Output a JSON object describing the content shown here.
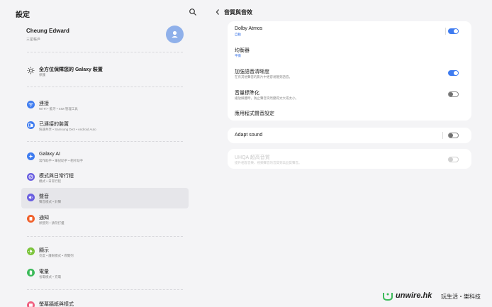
{
  "left": {
    "title": "設定",
    "account": {
      "name": "Cheung Edward",
      "subtitle": "三星帳戶"
    },
    "items": [
      {
        "label": "全方位保障您的 Galaxy 裝置",
        "sub": "保護",
        "icon": "bulb-icon",
        "color": "#ffffff"
      },
      {
        "label": "連接",
        "sub": "Wi-Fi • 藍牙 • SIM 管理工具",
        "icon": "wifi-icon",
        "color": "#3f7cf0"
      },
      {
        "label": "已連接的裝置",
        "sub": "快速共享 • Samsung DeX • Android Auto",
        "icon": "devices-icon",
        "color": "#3f7cf0"
      },
      {
        "label": "Galaxy AI",
        "sub": "寫作助手 • 筆記助手 • 相片助手",
        "icon": "ai-icon",
        "color": "#3f7cf0"
      },
      {
        "label": "模式與日常行程",
        "sub": "模式 • 日常行程",
        "icon": "modes-icon",
        "color": "#6a5fe0"
      },
      {
        "label": "聲音",
        "sub": "聲音模式 • 鈴聲",
        "icon": "sound-icon",
        "color": "#6a5fe0"
      },
      {
        "label": "通知",
        "sub": "狀態列 • 請勿打擾",
        "icon": "notification-icon",
        "color": "#f0602b"
      },
      {
        "label": "顯示",
        "sub": "亮度 • 護眼模式 • 導覽列",
        "icon": "display-icon",
        "color": "#7cc43c"
      },
      {
        "label": "電量",
        "sub": "省電模式 • 充電",
        "icon": "battery-icon",
        "color": "#3cba5a"
      },
      {
        "label": "螢幕牆紙與樣式",
        "sub": "",
        "icon": "wallpaper-icon",
        "color": "#f06080"
      }
    ]
  },
  "right": {
    "title": "音質與音效",
    "card1": [
      {
        "title": "Dolby Atmos",
        "sub": "自動",
        "toggle": "on"
      },
      {
        "title": "均衡器",
        "sub": "平衡",
        "toggle": "none"
      },
      {
        "title": "加強語音清晰度",
        "sub": "在有其他聲音的影片中更容易聽到語音。",
        "toggle": "on"
      },
      {
        "title": "音量標準化",
        "sub": "播放媒體時，防止聲音突然變得太大或太小。",
        "toggle": "off"
      },
      {
        "title": "應用程式聲音設定",
        "sub": "",
        "toggle": "none"
      }
    ],
    "card2": {
      "title": "Adapt sound",
      "toggle": "off"
    },
    "card3": {
      "title": "UHQA 超高音質",
      "sub": "提升相容音樂、視頻聲音的音質到高品質聲音。",
      "toggle": "disabled"
    }
  },
  "watermark": {
    "brand": "unwire.hk",
    "slogan": "玩生活・樂科技"
  }
}
